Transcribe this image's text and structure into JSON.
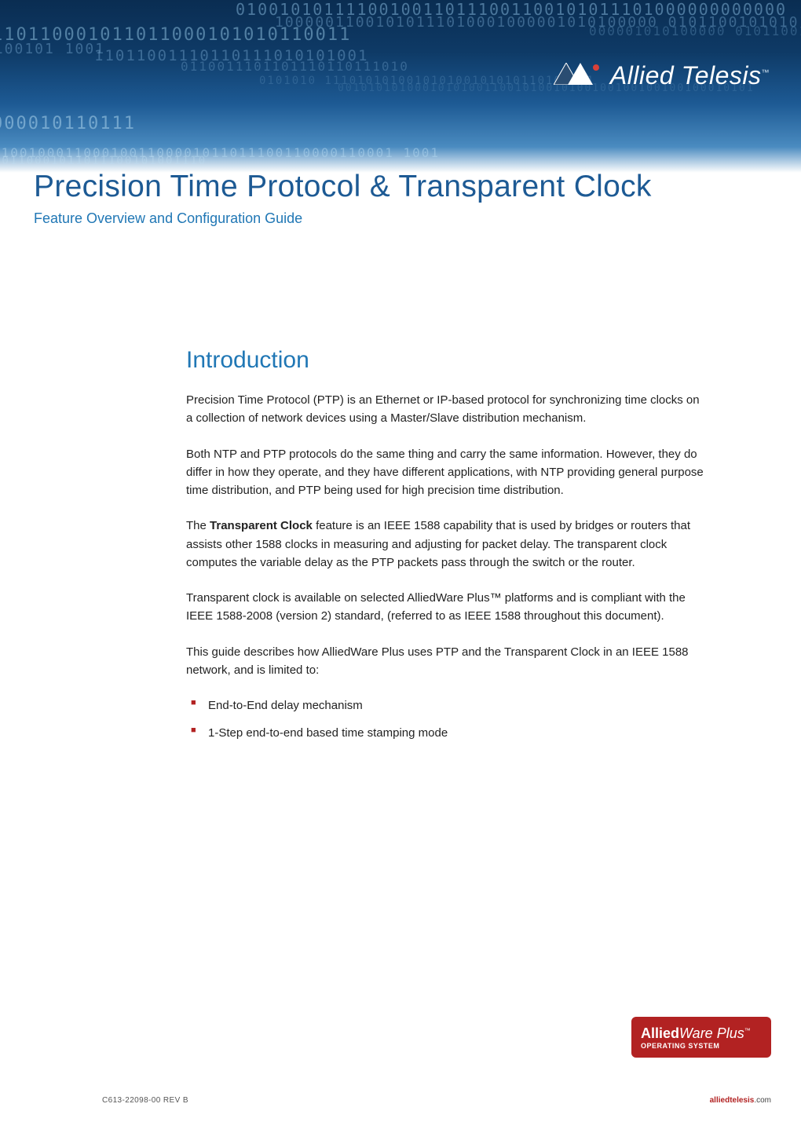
{
  "header": {
    "brand_name": "Allied Telesis",
    "brand_tm": "™",
    "binary_decor": "110110001011011000101010110011011001110110111010 0101001010 1111001001101110011001010111010001 000001010100000 0101100101010 000010110111 110010001100010011000010110111001100 001100010110111001 1001 0011 11100011011011100101001110 100101 0001101010110100 10110 100100010101 101 101 010011100111 0100110101110"
  },
  "title": {
    "main": "Precision Time Protocol & Transparent Clock",
    "subtitle": "Feature Overview and Configuration Guide"
  },
  "section": {
    "heading": "Introduction",
    "paragraphs": [
      "Precision Time Protocol (PTP) is an Ethernet or IP-based protocol for synchronizing time clocks on a collection of network devices using a Master/Slave distribution mechanism.",
      "Both NTP and PTP protocols do the same thing and carry the same information. However, they do differ in how they operate, and they have different applications, with NTP providing general purpose time distribution, and PTP being used for high precision time distribution.",
      {
        "pre": "The ",
        "bold": "Transparent Clock",
        "post": " feature is an IEEE 1588 capability that is used by bridges or routers that assists other 1588 clocks in measuring and adjusting for packet delay. The transparent clock computes the variable delay as the PTP packets pass through the switch or the router."
      },
      "Transparent clock is available on selected AlliedWare Plus™ platforms and is compliant with the IEEE 1588-2008 (version 2) standard, (referred to as IEEE 1588 throughout this document).",
      "This guide describes how AlliedWare Plus uses PTP and the Transparent Clock in an IEEE 1588 network, and is limited to:"
    ],
    "bullets": [
      "End-to-End delay mechanism",
      "1-Step end-to-end based time stamping mode"
    ]
  },
  "badge": {
    "line1_bold": "Allied",
    "line1_light": "Ware Plus",
    "line1_tm": "™",
    "line2": "OPERATING SYSTEM"
  },
  "footer": {
    "doc_ref": "C613-22098-00 REV B",
    "link_accent": "alliedtelesis",
    "link_suffix": ".com"
  }
}
